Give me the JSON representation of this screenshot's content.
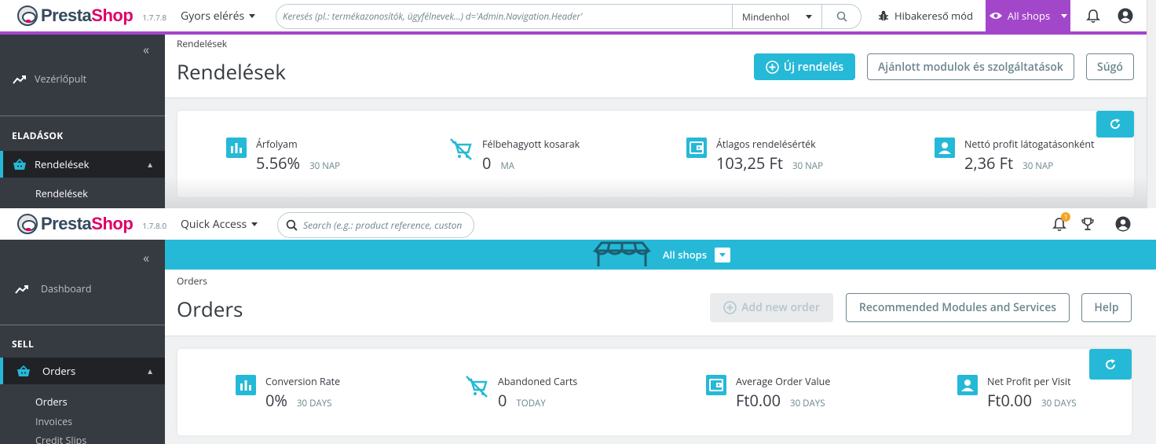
{
  "screen1": {
    "brand": {
      "name_a": "Presta",
      "name_b": "Shop",
      "version": "1.7.7.8"
    },
    "quick_access": "Gyors elérés",
    "search": {
      "placeholder": "Keresés (pl.: termékazonosítók, ügyfélnevek...) d='Admin.Navigation.Header'",
      "scope": "Mindenhol"
    },
    "debug_mode": "Hibakereső mód",
    "shops": "All shops",
    "sidebar": {
      "dashboard": "Vezérlőpult",
      "section": "ELADÁSOK",
      "active": "Rendelések",
      "sub": [
        "Rendelések"
      ]
    },
    "breadcrumb": "Rendelések",
    "title": "Rendelések",
    "buttons": {
      "new_order": "Új rendelés",
      "modules": "Ajánlott modulok és szolgáltatások",
      "help": "Súgó"
    },
    "kpis": [
      {
        "label": "Árfolyam",
        "value": "5.56%",
        "period": "30 NAP"
      },
      {
        "label": "Félbehagyott kosarak",
        "value": "0",
        "period": "MA"
      },
      {
        "label": "Átlagos rendelésérték",
        "value": "103,25 Ft",
        "period": "30 NAP"
      },
      {
        "label": "Nettó profit látogatásonként",
        "value": "2,36 Ft",
        "period": "30 NAP"
      }
    ]
  },
  "screen2": {
    "brand": {
      "name_a": "Presta",
      "name_b": "Shop",
      "version": "1.7.8.0"
    },
    "quick_access": "Quick Access",
    "search": {
      "placeholder": "Search (e.g.: product reference, custon"
    },
    "notifications_count": "1",
    "shops": "All shops",
    "sidebar": {
      "dashboard": "Dashboard",
      "section": "SELL",
      "active": "Orders",
      "sub": [
        "Orders",
        "Invoices",
        "Credit Slips"
      ]
    },
    "breadcrumb": "Orders",
    "title": "Orders",
    "buttons": {
      "new_order": "Add new order",
      "modules": "Recommended Modules and Services",
      "help": "Help"
    },
    "kpis": [
      {
        "label": "Conversion Rate",
        "value": "0%",
        "period": "30 DAYS"
      },
      {
        "label": "Abandoned Carts",
        "value": "0",
        "period": "TODAY"
      },
      {
        "label": "Average Order Value",
        "value": "Ft0.00",
        "period": "30 DAYS"
      },
      {
        "label": "Net Profit per Visit",
        "value": "Ft0.00",
        "period": "30 DAYS"
      }
    ]
  },
  "colors": {
    "accent": "#25b9d7",
    "purple": "#a347ca",
    "sidebar": "#363a41",
    "brand_pink": "#df0067"
  }
}
